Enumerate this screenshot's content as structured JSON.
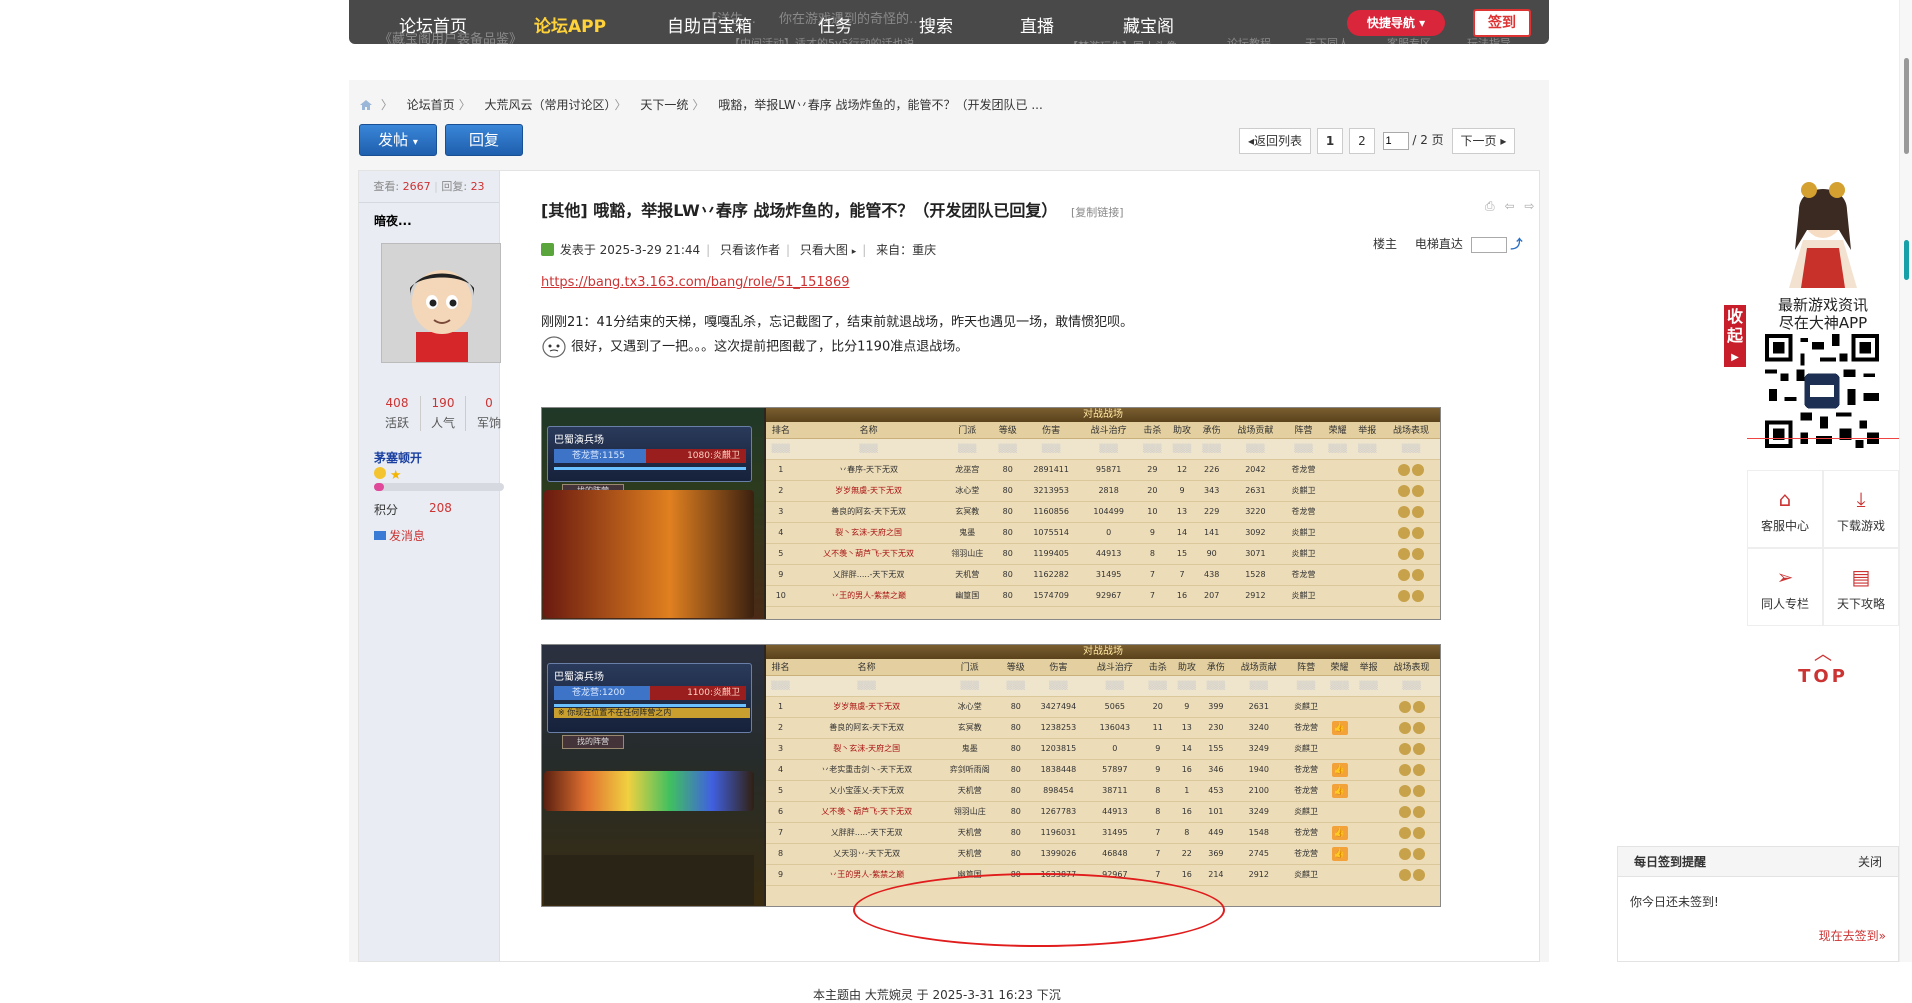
{
  "topnav": {
    "items": [
      "论坛首页",
      "论坛APP",
      "自助百宝箱",
      "任务",
      "搜索",
      "直播",
      "藏宝阁"
    ],
    "quick_nav": "快捷导航",
    "signin": "签到",
    "bg_lines": [
      "【洋生…",
      "你在游戏遇到的奇怪的…",
      "《藏宝阁用户装备品鉴》",
      "【中间活动】适才的5v5行动的话也说…",
      "【梦游玩先】同人头像…",
      "论坛教程",
      "天下同人",
      "客服专区",
      "玩法指导"
    ]
  },
  "breadcrumb": [
    "论坛首页",
    "大荒风云（常用讨论区）",
    "天下一统",
    "哦豁，举报LW丷春序 战场炸鱼的，能管不？（开发团队已 ..."
  ],
  "buttons": {
    "post": "发帖",
    "reply": "回复"
  },
  "pager": {
    "back": "返回列表",
    "page1": "1",
    "page2": "2",
    "current_input": "1",
    "total": "/ 2 页",
    "next": "下一页"
  },
  "sidebar": {
    "views_label": "查看:",
    "views": "2667",
    "replies_label": "回复:",
    "replies": "23",
    "author": "暗夜...",
    "stats": [
      {
        "value": "408",
        "label": "活跃"
      },
      {
        "value": "190",
        "label": "人气"
      },
      {
        "value": "0",
        "label": "军饷"
      }
    ],
    "rank": "茅塞顿开",
    "level_fraction": 0.08,
    "points_label": "积分",
    "points_value": "208",
    "message": "发消息"
  },
  "post": {
    "tag": "[其他]",
    "title": "哦豁，举报LW丷春序 战场炸鱼的，能管不？（开发团队已回复）",
    "copy_link": "[复制链接]",
    "posted_at": "发表于 2025-3-29 21:44",
    "only_author": "只看该作者",
    "big_image": "只看大图",
    "from": "来自：重庆",
    "floor_owner": "楼主",
    "elevator": "电梯直达",
    "link": "https://bang.tx3.163.com/bang/role/51_151869",
    "line1": "刚刚21：41分结束的天梯，嘎嘎乱杀，忘记截图了，结束前就退战场，昨天也遇见一场，敢情惯犯呗。",
    "line2": "很好，又遇到了一把。。。这次提前把图截了，比分1190准点退战场。",
    "demoted": "本主题由 大荒婉灵 于 2025-3-31 16:23 下沉"
  },
  "shot1": {
    "hud_title": "巴蜀演兵场",
    "left_score": "苍龙营:1155",
    "right_score": "1080:炎麒卫",
    "find_team": "找的阵营",
    "table_title": "对战战场",
    "headers": [
      "排名",
      "名称",
      "门派",
      "等级",
      "伤害",
      "战斗治疗",
      "击杀",
      "助攻",
      "承伤",
      "战场贡献",
      "阵营",
      "荣耀",
      "举报",
      "战场表现"
    ],
    "rows": [
      [
        "1",
        "丷春序-天下无双",
        "龙巫宫",
        "80",
        "2891411",
        "95871",
        "29",
        "12",
        "226",
        "2042",
        "苍龙营"
      ],
      [
        "2",
        "岁岁無虞-天下无双",
        "冰心堂",
        "80",
        "3213953",
        "2818",
        "20",
        "9",
        "343",
        "2631",
        "炎麒卫"
      ],
      [
        "3",
        "善良的阿玄-天下无双",
        "玄冥教",
        "80",
        "1160856",
        "104499",
        "10",
        "13",
        "229",
        "3220",
        "苍龙营"
      ],
      [
        "4",
        "裂丶玄沫-天府之国",
        "鬼墨",
        "80",
        "1075514",
        "0",
        "9",
        "14",
        "141",
        "3092",
        "炎麒卫"
      ],
      [
        "5",
        "乂不羡丶葫芦飞-天下无双",
        "翎羽山庄",
        "80",
        "1199405",
        "44913",
        "8",
        "15",
        "90",
        "3071",
        "炎麒卫"
      ],
      [
        "9",
        "乂胖胖.....-天下无双",
        "天机营",
        "80",
        "1162282",
        "31495",
        "7",
        "7",
        "438",
        "1528",
        "苍龙营"
      ],
      [
        "10",
        "丷王的男人-紫禁之巅",
        "幽篁国",
        "80",
        "1574709",
        "92967",
        "7",
        "16",
        "207",
        "2912",
        "炎麒卫"
      ]
    ]
  },
  "shot2": {
    "hud_title": "巴蜀演兵场",
    "left_score": "苍龙营:1200",
    "right_score": "1100:炎麒卫",
    "note": "※ 你现在位置不在任何阵营之内",
    "find_team": "找的阵营",
    "table_title": "对战战场",
    "headers": [
      "排名",
      "名称",
      "门派",
      "等级",
      "伤害",
      "战斗治疗",
      "击杀",
      "助攻",
      "承伤",
      "战场贡献",
      "阵营",
      "荣耀",
      "举报",
      "战场表现"
    ],
    "rows": [
      [
        "1",
        "岁岁無虞-天下无双",
        "冰心堂",
        "80",
        "3427494",
        "5065",
        "20",
        "9",
        "399",
        "2631",
        "炎麒卫"
      ],
      [
        "2",
        "善良的阿玄-天下无双",
        "玄冥教",
        "80",
        "1238253",
        "136043",
        "11",
        "13",
        "230",
        "3240",
        "苍龙营"
      ],
      [
        "3",
        "裂丶玄沫-天府之国",
        "鬼墨",
        "80",
        "1203815",
        "0",
        "9",
        "14",
        "155",
        "3249",
        "炎麒卫"
      ],
      [
        "4",
        "丷老实重击剑丶-天下无双",
        "弈剑听雨阁",
        "80",
        "1838448",
        "57897",
        "9",
        "16",
        "346",
        "1940",
        "苍龙营"
      ],
      [
        "5",
        "乂小宝莲乂-天下无双",
        "天机营",
        "80",
        "898454",
        "38711",
        "8",
        "1",
        "453",
        "2100",
        "苍龙营"
      ],
      [
        "6",
        "乂不羡丶葫芦飞-天下无双",
        "翎羽山庄",
        "80",
        "1267783",
        "44913",
        "8",
        "16",
        "101",
        "3249",
        "炎麒卫"
      ],
      [
        "7",
        "乂胖胖.....-天下无双",
        "天机营",
        "80",
        "1196031",
        "31495",
        "7",
        "8",
        "449",
        "1548",
        "苍龙营"
      ],
      [
        "8",
        "乂天羽丷-天下无双",
        "天机营",
        "80",
        "1399026",
        "46848",
        "7",
        "22",
        "369",
        "2745",
        "苍龙营"
      ],
      [
        "9",
        "丷王的男人-紫禁之巅",
        "幽篁国",
        "80",
        "1633877",
        "92967",
        "7",
        "16",
        "214",
        "2912",
        "炎麒卫"
      ]
    ]
  },
  "float": {
    "collapse": "收起",
    "app_line1": "最新游戏资讯",
    "app_line2": "尽在大神APP",
    "service": "客服中心",
    "download": "下载游戏",
    "fan_column": "同人专栏",
    "guide": "天下攻略",
    "top": "TOP"
  },
  "sign": {
    "title": "每日签到提醒",
    "close": "关闭",
    "body": "你今日还未签到!",
    "go": "现在去签到»"
  }
}
